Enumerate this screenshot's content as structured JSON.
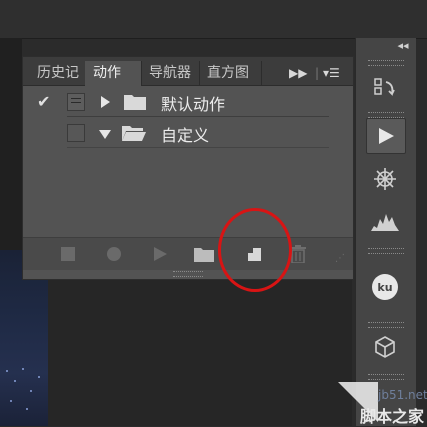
{
  "panel": {
    "tabs": [
      {
        "label": "历史记"
      },
      {
        "label": "动作"
      },
      {
        "label": "导航器"
      },
      {
        "label": "直方图"
      }
    ],
    "menu_icons": [
      "expand-arrows-icon",
      "panel-menu-icon"
    ],
    "rows": [
      {
        "label": "默认动作",
        "checked": true,
        "expanded": false
      },
      {
        "label": "自定义",
        "checked": false,
        "expanded": true
      }
    ],
    "toolbar": [
      "stop-icon",
      "record-icon",
      "play-icon",
      "new-set-folder-icon",
      "new-action-icon",
      "delete-icon"
    ]
  },
  "dock": {
    "icons": [
      "history-icon",
      "play-actions-icon",
      "navigator-icon",
      "histogram-icon",
      "ku-icon",
      "3d-icon"
    ]
  },
  "watermark": {
    "site": "jb51.net",
    "name": "脚本之家"
  },
  "colors": {
    "highlight": "#d81414",
    "panel_bg": "#535353",
    "dock_bg": "#454545"
  }
}
